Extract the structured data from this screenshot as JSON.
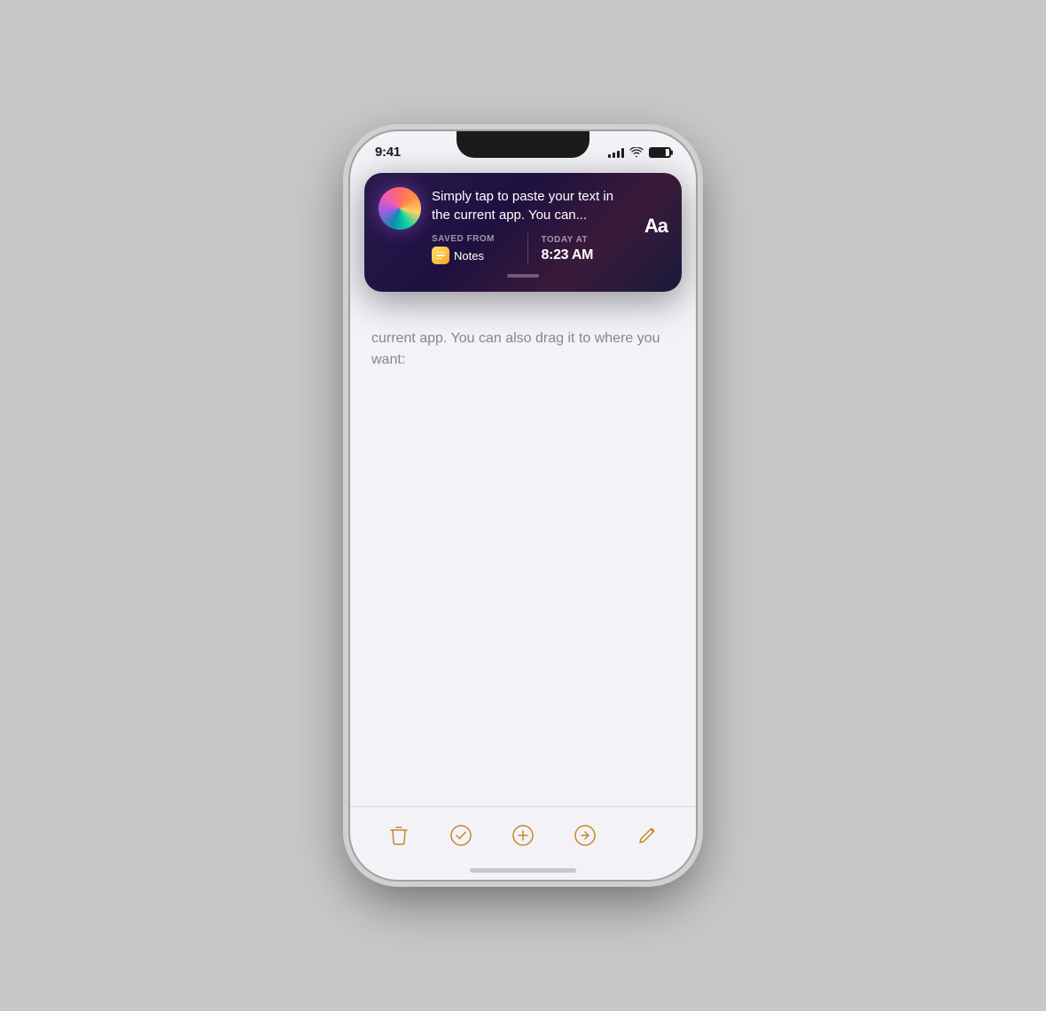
{
  "status_bar": {
    "time": "9:41",
    "battery_level": 80
  },
  "siri_popup": {
    "main_text_line1": "Simply tap to paste your text in",
    "main_text_line2": "the current app. You can...",
    "saved_from_label": "SAVED FROM",
    "source_app": "Notes",
    "today_at_label": "TODAY AT",
    "time": "8:23 AM",
    "aa_button": "Aa"
  },
  "note_content": {
    "text": "current app. You can also drag it to where you want:"
  },
  "toolbar": {
    "delete_label": "Delete",
    "check_label": "Check",
    "add_label": "Add",
    "share_label": "Share",
    "compose_label": "Compose"
  }
}
